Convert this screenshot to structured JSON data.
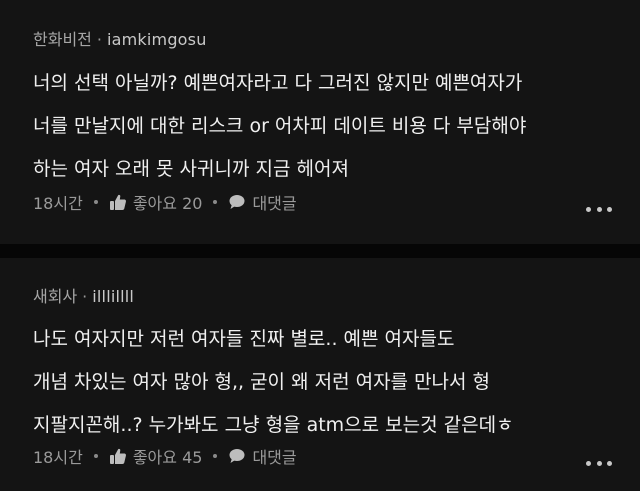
{
  "comments": [
    {
      "source": "한화비전",
      "username": "iamkimgosu",
      "body_lines": [
        "너의 선택 아닐까? 예쁜여자라고 다 그러진 않지만 예쁜여자가",
        "너를 만날지에 대한 리스크 or 어차피 데이트 비용 다 부담해야",
        "하는 여자 오래 못 사귀니까 지금 헤어져"
      ],
      "time": "18시간",
      "like_label": "좋아요",
      "like_count": "20",
      "reply_label": "대댓글",
      "icons": [
        "thumbs-up-icon",
        "speech-bubble-icon",
        "more-icon"
      ]
    },
    {
      "source": "새회사",
      "username": "illlillll",
      "body_lines": [
        "나도 여자지만 저런 여자들 진짜 별로.. 예쁜 여자들도",
        "개념 차있는 여자 많아 형,, 굳이 왜 저런 여자를 만나서 형",
        "지팔지꼰해..? 누가봐도 그냥 형을 atm으로 보는것 같은데ㅎ"
      ],
      "time": "18시간",
      "like_label": "좋아요",
      "like_count": "45",
      "reply_label": "대댓글",
      "icons": [
        "thumbs-up-icon",
        "speech-bubble-icon",
        "more-icon"
      ]
    }
  ],
  "colors": {
    "background": "#0b0b0b",
    "card": "#141414",
    "text": "#f0f0f0",
    "meta": "#a6a6a6"
  }
}
